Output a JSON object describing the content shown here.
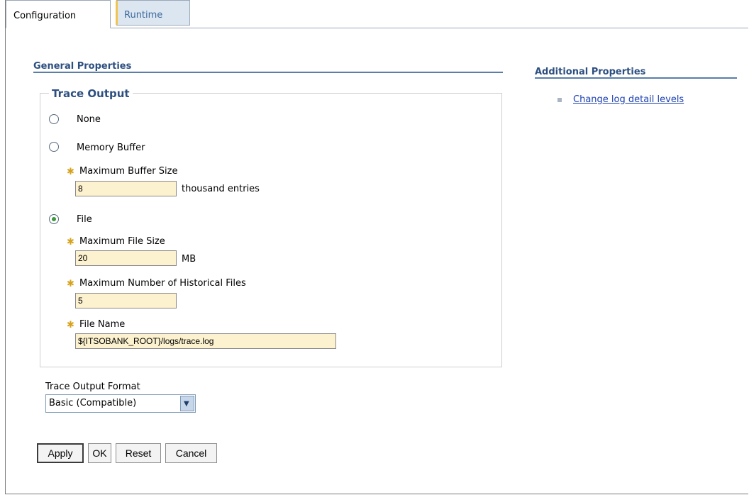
{
  "tabs": {
    "configuration": "Configuration",
    "runtime": "Runtime"
  },
  "general_properties": {
    "title": "General Properties",
    "trace_output": {
      "legend": "Trace Output",
      "options": {
        "none": "None",
        "memory_buffer": "Memory Buffer",
        "file": "File"
      },
      "selected": "File",
      "max_buffer_size": {
        "label": "Maximum Buffer Size",
        "value": "8",
        "unit": "thousand entries"
      },
      "max_file_size": {
        "label": "Maximum File Size",
        "value": "20",
        "unit": "MB"
      },
      "max_historical_files": {
        "label": "Maximum Number of Historical Files",
        "value": "5"
      },
      "file_name": {
        "label": "File Name",
        "value": "${ITSOBANK_ROOT}/logs/trace.log"
      }
    },
    "trace_output_format": {
      "label": "Trace Output Format",
      "selected": "Basic (Compatible)"
    }
  },
  "additional_properties": {
    "title": "Additional Properties",
    "links": [
      "Change log detail levels"
    ]
  },
  "buttons": {
    "apply": "Apply",
    "ok": "OK",
    "reset": "Reset",
    "cancel": "Cancel"
  },
  "colors": {
    "heading": "#2d4f80",
    "input_bg": "#fdf2cf",
    "required_marker": "#d6a21a",
    "link": "#1a3fb0"
  }
}
